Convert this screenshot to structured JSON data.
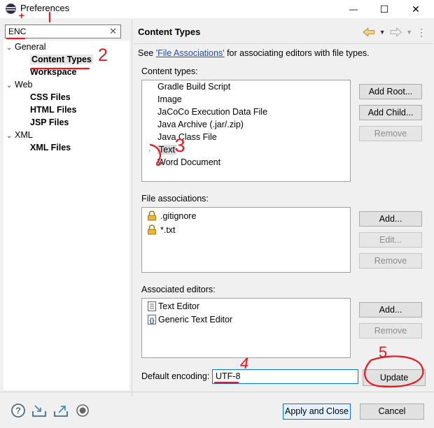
{
  "window": {
    "title": "Preferences",
    "minimize": "—",
    "maximize": "☐",
    "close": "✕"
  },
  "filter": {
    "value": "ENC",
    "clear": "✕"
  },
  "tree": [
    {
      "label": "General",
      "level": 0,
      "caret": "⌄",
      "bold": false
    },
    {
      "label": "Content Types",
      "level": 1,
      "caret": "",
      "bold": true,
      "selected": true
    },
    {
      "label": "Workspace",
      "level": 1,
      "caret": "",
      "bold": true
    },
    {
      "label": "Web",
      "level": 0,
      "caret": "⌄",
      "bold": false
    },
    {
      "label": "CSS Files",
      "level": 1,
      "caret": "",
      "bold": true
    },
    {
      "label": "HTML Files",
      "level": 1,
      "caret": "",
      "bold": true
    },
    {
      "label": "JSP Files",
      "level": 1,
      "caret": "",
      "bold": true
    },
    {
      "label": "XML",
      "level": 0,
      "caret": "⌄",
      "bold": false
    },
    {
      "label": "XML Files",
      "level": 1,
      "caret": "",
      "bold": true
    }
  ],
  "page": {
    "title": "Content Types",
    "see_prefix": "See ",
    "see_link": "'File Associations'",
    "see_suffix": " for associating editors with file types."
  },
  "content_types": {
    "label": "Content types:",
    "items": [
      "Gradle Build Script",
      "Image",
      "JaCoCo Execution Data File",
      "Java Archive (.jar/.zip)",
      "Java Class File",
      "Text",
      "Word Document"
    ],
    "buttons": [
      "Add Root...",
      "Add Child...",
      "Remove"
    ]
  },
  "file_associations": {
    "label": "File associations:",
    "items": [
      ".gitignore",
      "*.txt"
    ],
    "buttons": [
      "Add...",
      "Edit...",
      "Remove"
    ]
  },
  "associated_editors": {
    "label": "Associated editors:",
    "items": [
      "Text Editor",
      "Generic Text Editor"
    ],
    "buttons": [
      "Add...",
      "Remove"
    ]
  },
  "encoding": {
    "label": "Default encoding:",
    "value": "UTF-8",
    "button": "Update"
  },
  "footer": {
    "apply": "Apply and Close",
    "cancel": "Cancel"
  },
  "annotations": [
    "+",
    "2",
    "3",
    "4",
    "5"
  ],
  "colors": {
    "accent": "#0078d7",
    "link": "#1a4ec9",
    "annotation": "#e8161d"
  }
}
